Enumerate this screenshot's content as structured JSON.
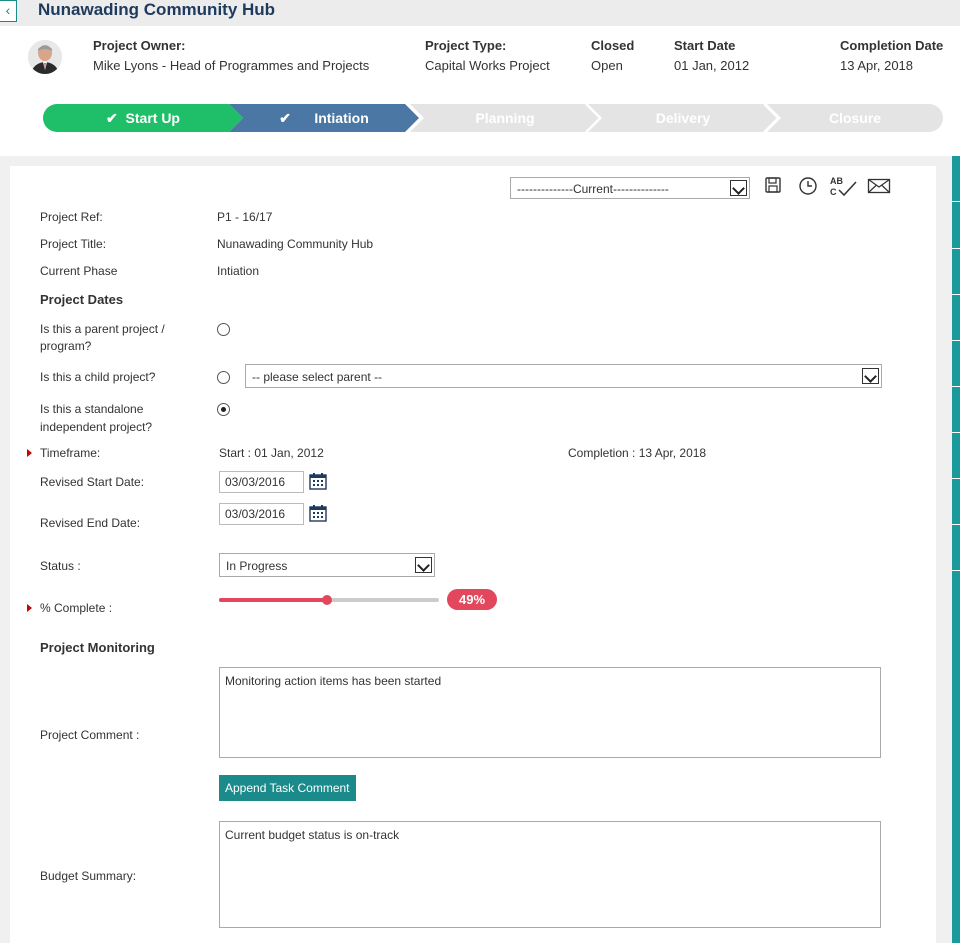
{
  "header": {
    "back_icon": "chevron-left-icon",
    "title": "Nunawading Community Hub"
  },
  "info": {
    "owner_label": "Project Owner:",
    "owner_value": "Mike Lyons - Head of Programmes and Projects",
    "type_label": "Project Type:",
    "type_value": "Capital Works Project",
    "closed_label": "Closed",
    "closed_value": "Open",
    "start_label": "Start Date",
    "start_value": "01 Jan, 2012",
    "completion_label": "Completion Date",
    "completion_value": "13 Apr, 2018"
  },
  "phases": [
    {
      "label": "Start Up",
      "state": "done",
      "color": "#1fbf6a"
    },
    {
      "label": "Intiation",
      "state": "current",
      "color": "#4a77a3"
    },
    {
      "label": "Planning",
      "state": "todo",
      "color": "#e4e4e4"
    },
    {
      "label": "Delivery",
      "state": "todo",
      "color": "#e4e4e4"
    },
    {
      "label": "Closure",
      "state": "todo",
      "color": "#e4e4e4"
    }
  ],
  "toolbar": {
    "version_select": "--------------Current--------------",
    "icons": [
      "save-icon",
      "history-icon",
      "spellcheck-icon",
      "email-icon"
    ],
    "spellcheck_text": "ABC"
  },
  "form": {
    "ref_label": "Project Ref:",
    "ref_value": "P1 - 16/17",
    "title_label": "Project Title:",
    "title_value": "Nunawading Community Hub",
    "phase_label": "Current Phase",
    "phase_value": "Intiation",
    "dates_section": "Project Dates",
    "parent_label": "Is this a parent project / program?",
    "child_label": "Is this a child project?",
    "parent_select": "-- please select parent --",
    "standalone_label": "Is this a standalone independent project?",
    "timeframe_label": "Timeframe:",
    "timeframe_start": "Start : 01 Jan, 2012",
    "timeframe_completion": "Completion : 13 Apr, 2018",
    "revised_start_label": "Revised Start Date:",
    "revised_start_value": "03/03/2016",
    "revised_end_label": "Revised End Date:",
    "revised_end_value": "03/03/2016",
    "status_label": "Status :",
    "status_value": "In Progress",
    "complete_label": "% Complete :",
    "complete_value": 49,
    "complete_text": "49%",
    "monitoring_section": "Project Monitoring",
    "comment_label": "Project Comment :",
    "comment_value": "Monitoring action items has been started",
    "append_button": "Append Task Comment",
    "budget_label": "Budget Summary:",
    "budget_value": "Current budget status is on-track"
  },
  "colors": {
    "accent": "#1a8a8a",
    "progress": "#e2475d",
    "required": "#cc0000"
  }
}
